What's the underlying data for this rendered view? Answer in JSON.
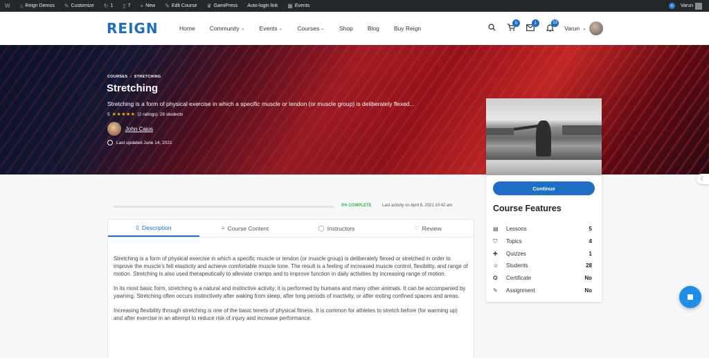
{
  "adminbar": {
    "items": [
      {
        "icon": "wordpress-icon",
        "glyph": "W",
        "label": ""
      },
      {
        "icon": "home-icon",
        "glyph": "⌂",
        "label": "Reign Demos"
      },
      {
        "icon": "brush-icon",
        "glyph": "✎",
        "label": "Customize"
      },
      {
        "icon": "updates-icon",
        "glyph": "↻",
        "label": "1"
      },
      {
        "icon": "comments-icon",
        "glyph": "▯",
        "label": "7"
      },
      {
        "icon": "plus-icon",
        "glyph": "+",
        "label": "New"
      },
      {
        "icon": "edit-icon",
        "glyph": "✎",
        "label": "Edit Course"
      },
      {
        "icon": "crown-icon",
        "glyph": "♛",
        "label": "GamiPress"
      },
      {
        "icon": "",
        "glyph": "",
        "label": "Auto-login link"
      },
      {
        "icon": "calendar-icon",
        "glyph": "▦",
        "label": "Events"
      }
    ],
    "notif_count": "6",
    "user": "Varun"
  },
  "header": {
    "logo": "REIGN",
    "nav": [
      {
        "label": "Home",
        "chevron": false
      },
      {
        "label": "Community",
        "chevron": true
      },
      {
        "label": "Events",
        "chevron": true
      },
      {
        "label": "Courses",
        "chevron": true
      },
      {
        "label": "Shop",
        "chevron": false
      },
      {
        "label": "Blog",
        "chevron": false
      },
      {
        "label": "Buy Reign",
        "chevron": false
      }
    ],
    "cart_count": "0",
    "messages_count": "1",
    "notifications_count": "13",
    "user_name": "Varun"
  },
  "hero": {
    "breadcrumb_1": "COURSES",
    "breadcrumb_sep": "»",
    "breadcrumb_2": "STRETCHING",
    "title": "Stretching",
    "description": "Stretching is a form of physical exercise in which a specific muscle or tendon (or muscle group) is deliberately flexed...",
    "rating_value": "5",
    "stars": "★★★★★",
    "rating_count": "(2 ratings)",
    "students": "28 students",
    "instructor": "John Caius",
    "last_updated": "Last updated June 14, 2021"
  },
  "progress": {
    "fraction": 0,
    "percent_label": "0% COMPLETE",
    "last_activity": "Last activity on April 8, 2021 10:42 am"
  },
  "tabs": [
    {
      "label": "Description",
      "icon": "document-icon",
      "glyph": "▯",
      "active": true
    },
    {
      "label": "Course Content",
      "icon": "list-icon",
      "glyph": "≡",
      "active": false
    },
    {
      "label": "Instructors",
      "icon": "user-icon",
      "glyph": "◯",
      "active": false
    },
    {
      "label": "Review",
      "icon": "heart-icon",
      "glyph": "♡",
      "active": false
    }
  ],
  "description": [
    "Stretching is a form of physical exercise in which a specific muscle or tendon (or muscle group) is deliberately flexed or stretched in order to improve the muscle's felt elasticity and achieve comfortable muscle tone. The result is a feeling of increased muscle control, flexibility, and range of motion. Stretching is also used therapeutically to alleviate cramps and to improve function in daily activities by increasing range of motion.",
    "In its most basic form, stretching is a natural and instinctive activity; it is performed by humans and many other animals. It can be accompanied by yawning. Stretching often occurs instinctively after waking from sleep, after long periods of inactivity, or after exiting confined spaces and areas.",
    "Increasing flexibility through stretching is one of the basic tenets of physical fitness. It is common for athletes to stretch before (for warming up) and after exercise in an attempt to reduce risk of injury and increase performance."
  ],
  "sidebar": {
    "continue_label": "Continue",
    "features_title": "Course Features",
    "features": [
      {
        "label": "Lessons",
        "value": "5",
        "icon": "lessons-icon",
        "glyph": "▤"
      },
      {
        "label": "Topics",
        "value": "4",
        "icon": "bookmark-icon",
        "glyph": "⛉"
      },
      {
        "label": "Quizzes",
        "value": "1",
        "icon": "puzzle-icon",
        "glyph": "✚"
      },
      {
        "label": "Students",
        "value": "28",
        "icon": "students-icon",
        "glyph": "☺"
      },
      {
        "label": "Certificate",
        "value": "No",
        "icon": "certificate-icon",
        "glyph": "✪"
      },
      {
        "label": "Assignment",
        "value": "No",
        "icon": "assignment-icon",
        "glyph": "✎"
      }
    ]
  },
  "colors": {
    "accent": "#1d6ec4",
    "progress": "#38b24a",
    "fab": "#1d8fe8"
  }
}
